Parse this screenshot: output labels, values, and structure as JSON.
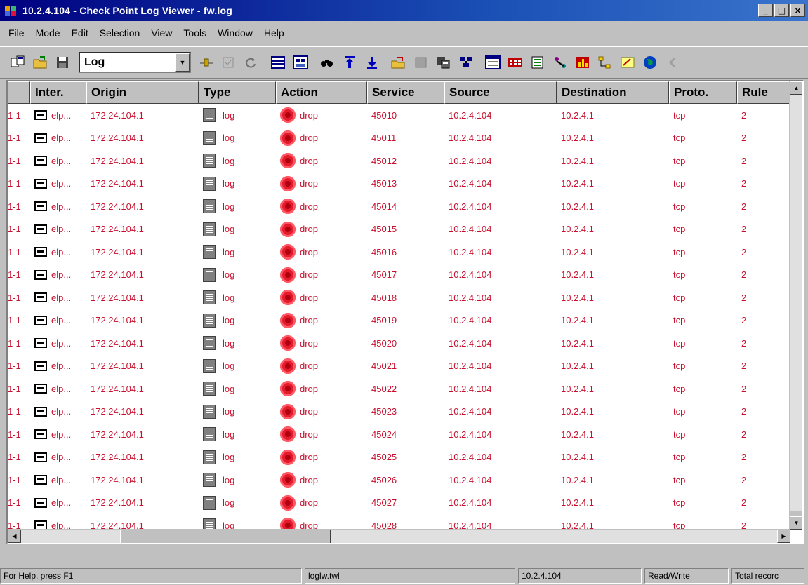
{
  "window": {
    "title": "10.2.4.104 - Check Point Log Viewer - fw.log",
    "controls": [
      "_",
      "□",
      "×"
    ]
  },
  "menu": [
    {
      "label": "File"
    },
    {
      "label": "Mode"
    },
    {
      "label": "Edit"
    },
    {
      "label": "Selection"
    },
    {
      "label": "View"
    },
    {
      "label": "Tools"
    },
    {
      "label": "Window"
    },
    {
      "label": "Help"
    }
  ],
  "toolbar": {
    "mode_value": "Log",
    "buttons_left": [
      "new-window-icon",
      "open-folder-icon",
      "save-icon"
    ],
    "buttons_right": [
      "filter-icon",
      "select-all-icon",
      "refresh-icon",
      "list-view-icon",
      "account-view-icon",
      "find-icon",
      "first-record-icon",
      "last-record-icon",
      "export-icon",
      "stop-icon",
      "copy-icon",
      "tree-icon",
      "columns-icon",
      "block-icon",
      "options-icon",
      "resolve-icon",
      "chart-icon",
      "hierarchy-icon",
      "notes-icon",
      "globe-icon",
      "back-icon"
    ]
  },
  "table": {
    "columns": [
      "",
      "Inter.",
      "Origin",
      "Type",
      "Action",
      "Service",
      "Source",
      "Destination",
      "Proto.",
      "Rule"
    ],
    "rows": [
      {
        "num": "1-1",
        "inter": "elp...",
        "origin": "172.24.104.1",
        "type": "log",
        "action": "drop",
        "service": "45010",
        "source": "10.2.4.104",
        "dest": "10.2.4.1",
        "proto": "tcp",
        "rule": "2"
      },
      {
        "num": "1-1",
        "inter": "elp...",
        "origin": "172.24.104.1",
        "type": "log",
        "action": "drop",
        "service": "45011",
        "source": "10.2.4.104",
        "dest": "10.2.4.1",
        "proto": "tcp",
        "rule": "2"
      },
      {
        "num": "1-1",
        "inter": "elp...",
        "origin": "172.24.104.1",
        "type": "log",
        "action": "drop",
        "service": "45012",
        "source": "10.2.4.104",
        "dest": "10.2.4.1",
        "proto": "tcp",
        "rule": "2"
      },
      {
        "num": "1-1",
        "inter": "elp...",
        "origin": "172.24.104.1",
        "type": "log",
        "action": "drop",
        "service": "45013",
        "source": "10.2.4.104",
        "dest": "10.2.4.1",
        "proto": "tcp",
        "rule": "2"
      },
      {
        "num": "1-1",
        "inter": "elp...",
        "origin": "172.24.104.1",
        "type": "log",
        "action": "drop",
        "service": "45014",
        "source": "10.2.4.104",
        "dest": "10.2.4.1",
        "proto": "tcp",
        "rule": "2"
      },
      {
        "num": "1-1",
        "inter": "elp...",
        "origin": "172.24.104.1",
        "type": "log",
        "action": "drop",
        "service": "45015",
        "source": "10.2.4.104",
        "dest": "10.2.4.1",
        "proto": "tcp",
        "rule": "2"
      },
      {
        "num": "1-1",
        "inter": "elp...",
        "origin": "172.24.104.1",
        "type": "log",
        "action": "drop",
        "service": "45016",
        "source": "10.2.4.104",
        "dest": "10.2.4.1",
        "proto": "tcp",
        "rule": "2"
      },
      {
        "num": "1-1",
        "inter": "elp...",
        "origin": "172.24.104.1",
        "type": "log",
        "action": "drop",
        "service": "45017",
        "source": "10.2.4.104",
        "dest": "10.2.4.1",
        "proto": "tcp",
        "rule": "2"
      },
      {
        "num": "1-1",
        "inter": "elp...",
        "origin": "172.24.104.1",
        "type": "log",
        "action": "drop",
        "service": "45018",
        "source": "10.2.4.104",
        "dest": "10.2.4.1",
        "proto": "tcp",
        "rule": "2"
      },
      {
        "num": "1-1",
        "inter": "elp...",
        "origin": "172.24.104.1",
        "type": "log",
        "action": "drop",
        "service": "45019",
        "source": "10.2.4.104",
        "dest": "10.2.4.1",
        "proto": "tcp",
        "rule": "2"
      },
      {
        "num": "1-1",
        "inter": "elp...",
        "origin": "172.24.104.1",
        "type": "log",
        "action": "drop",
        "service": "45020",
        "source": "10.2.4.104",
        "dest": "10.2.4.1",
        "proto": "tcp",
        "rule": "2"
      },
      {
        "num": "1-1",
        "inter": "elp...",
        "origin": "172.24.104.1",
        "type": "log",
        "action": "drop",
        "service": "45021",
        "source": "10.2.4.104",
        "dest": "10.2.4.1",
        "proto": "tcp",
        "rule": "2"
      },
      {
        "num": "1-1",
        "inter": "elp...",
        "origin": "172.24.104.1",
        "type": "log",
        "action": "drop",
        "service": "45022",
        "source": "10.2.4.104",
        "dest": "10.2.4.1",
        "proto": "tcp",
        "rule": "2"
      },
      {
        "num": "1-1",
        "inter": "elp...",
        "origin": "172.24.104.1",
        "type": "log",
        "action": "drop",
        "service": "45023",
        "source": "10.2.4.104",
        "dest": "10.2.4.1",
        "proto": "tcp",
        "rule": "2"
      },
      {
        "num": "1-1",
        "inter": "elp...",
        "origin": "172.24.104.1",
        "type": "log",
        "action": "drop",
        "service": "45024",
        "source": "10.2.4.104",
        "dest": "10.2.4.1",
        "proto": "tcp",
        "rule": "2"
      },
      {
        "num": "1-1",
        "inter": "elp...",
        "origin": "172.24.104.1",
        "type": "log",
        "action": "drop",
        "service": "45025",
        "source": "10.2.4.104",
        "dest": "10.2.4.1",
        "proto": "tcp",
        "rule": "2"
      },
      {
        "num": "1-1",
        "inter": "elp...",
        "origin": "172.24.104.1",
        "type": "log",
        "action": "drop",
        "service": "45026",
        "source": "10.2.4.104",
        "dest": "10.2.4.1",
        "proto": "tcp",
        "rule": "2"
      },
      {
        "num": "1-1",
        "inter": "elp...",
        "origin": "172.24.104.1",
        "type": "log",
        "action": "drop",
        "service": "45027",
        "source": "10.2.4.104",
        "dest": "10.2.4.1",
        "proto": "tcp",
        "rule": "2"
      },
      {
        "num": "1-1",
        "inter": "elp...",
        "origin": "172.24.104.1",
        "type": "log",
        "action": "drop",
        "service": "45028",
        "source": "10.2.4.104",
        "dest": "10.2.4.1",
        "proto": "tcp",
        "rule": "2"
      }
    ]
  },
  "status": {
    "help": "For Help, press F1",
    "file": "loglw.twl",
    "host": "10.2.4.104",
    "mode": "Read/Write",
    "records": "Total recorc"
  },
  "colors": {
    "row_text": "#c8102e",
    "title_bar": "#000080",
    "chrome": "#c0c0c0"
  }
}
